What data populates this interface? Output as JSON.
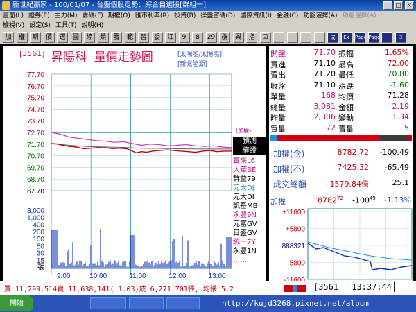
{
  "window": {
    "title": "新世紀贏家 - 100/01/07 - 台盤個股走勢：綜合自選股[群組一]"
  },
  "menu": {
    "row1": [
      "畫面(L)",
      "證券(E)",
      "主力(M)",
      "籌碼(F)",
      "期權(O)",
      "匯市利率(R)",
      "投資(B)",
      "操盤密碼(D)",
      "國際資訊(I)",
      "金融(C)",
      "功能選擇(A)",
      "功能選擇(A)"
    ],
    "row2": [
      "檢視(V)",
      "設定(S)",
      "工具(T)",
      "說明(H)"
    ]
  },
  "toolbar": {
    "buttons": [
      "加",
      "權",
      "期",
      "價",
      "選",
      "國",
      "綜",
      "類",
      "籌",
      "範",
      "智",
      "委",
      "江",
      "9",
      "8",
      "29",
      "群",
      "興",
      "指",
      "☑",
      "",
      "",
      "",
      "",
      "成",
      "Ex",
      "Page",
      "Page",
      "",
      "☐"
    ]
  },
  "chart": {
    "stock_code": "[3561]",
    "stock_name": "昇陽科",
    "chart_title": "量價走勢圖",
    "sectors": [
      "[太陽能/太陽能]",
      "[新兆能源]"
    ],
    "plus_label": "(加權)",
    "price_axis": [
      "77.70",
      "76.70",
      "75.70",
      "74.70",
      "73.70",
      "72.70",
      "71.70",
      "70.70",
      "69.70",
      "68.70",
      "67.70"
    ],
    "volume_axis": [
      "3,000",
      "1,000",
      "400",
      "200",
      "100",
      "50",
      "30",
      "15",
      "張"
    ],
    "time_axis": [
      "9:00",
      "10:00",
      "11:00",
      "12:00",
      "13:00"
    ],
    "broker_label_1": "預測",
    "broker_label_2": "權證",
    "brokers": [
      {
        "name": "寶來L6",
        "color": "#c0108a"
      },
      {
        "name": "大華BE",
        "color": "#c0108a"
      },
      {
        "name": "群益79",
        "color": "#000000"
      },
      {
        "name": "元大DJ",
        "color": "#2090c0"
      },
      {
        "name": "元大DI",
        "color": "#000000"
      },
      {
        "name": "凱基MB",
        "color": "#000000"
      },
      {
        "name": "永豐9N",
        "color": "#c0108a"
      },
      {
        "name": "元富GV",
        "color": "#000000"
      },
      {
        "name": "日盛GV",
        "color": "#000000"
      },
      {
        "name": "統一7Y",
        "color": "#c0108a"
      },
      {
        "name": "永豐1N",
        "color": "#000000"
      },
      {
        "name": "‥‥‥",
        "color": "#c0108a"
      }
    ]
  },
  "quote": {
    "rows": [
      {
        "l1": "開盤",
        "v1": "71.70",
        "l2": "振幅",
        "v2": "1.65%",
        "c1": "#c0108a",
        "c2": "#d00010"
      },
      {
        "l1": "買進",
        "v1": "71.10",
        "l2": "最高",
        "v2": "72.00",
        "c1": "#000000",
        "c2": "#d00010"
      },
      {
        "l1": "賣出",
        "v1": "71.20",
        "l2": "最低",
        "v2": "70.80",
        "c1": "#000000",
        "c2": "#007000"
      },
      {
        "l1": "收盤",
        "v1": "71.10",
        "l2": "漲跌",
        "v2": "-1.60",
        "c1": "#000000",
        "c2": "#007000"
      },
      {
        "l1": "單量",
        "v1": "168",
        "l2": "均價",
        "v2": "71.28",
        "c1": "#c0108a",
        "c2": "#000000"
      },
      {
        "l1": "總量",
        "v1": "3,081",
        "l2": "金額",
        "v2": "2.19",
        "c1": "#c0108a",
        "c2": "#c0108a"
      },
      {
        "l1": "昨量",
        "v1": "2,306",
        "l2": "變動",
        "v2": "1.34",
        "c1": "#c0108a",
        "c2": "#c0108a"
      },
      {
        "l1": "買量",
        "v1": "72",
        "l2": "賣量",
        "v2": "5",
        "c1": "#c0108a",
        "c2": "#c0108a"
      }
    ],
    "index_rows": [
      {
        "label": "加權(含)",
        "value": "8782.72",
        "change": "-100.49"
      },
      {
        "label": "加權(不)",
        "value": "7425.32",
        "change": "-65.49"
      },
      {
        "label": "成交總額",
        "value": "1579.84億",
        "change": "25.1"
      }
    ],
    "mini": {
      "label": "加權",
      "value_main": "8782",
      "value_sub": "72",
      "change_main": "-100",
      "change_sub": "49",
      "pct": "-1.13%",
      "axis": [
        "+11600",
        "+5800",
        "888321",
        "-5800",
        "-11600"
      ]
    }
  },
  "status": {
    "text": "買 11,299,514賣 11,638,141( 1.03)成 6,271,701張, 均張 5.2",
    "code": "3561",
    "time": "13:37:44"
  },
  "taskbar": {
    "start": "開始",
    "watermark": "http://kujd3268.pixnet.net/album"
  },
  "series": {
    "price": [
      [
        0,
        71.75
      ],
      [
        0.03,
        71.72
      ],
      [
        0.06,
        71.6
      ],
      [
        0.1,
        71.5
      ],
      [
        0.14,
        71.45
      ],
      [
        0.18,
        71.3
      ],
      [
        0.22,
        71.35
      ],
      [
        0.26,
        71.4
      ],
      [
        0.3,
        71.38
      ],
      [
        0.34,
        71.32
      ],
      [
        0.38,
        71.35
      ],
      [
        0.42,
        71.3
      ],
      [
        0.45,
        71.1
      ],
      [
        0.47,
        70.95
      ],
      [
        0.5,
        71.05
      ],
      [
        0.53,
        71.0
      ],
      [
        0.56,
        71.1
      ],
      [
        0.6,
        71.15
      ],
      [
        0.64,
        71.2
      ],
      [
        0.68,
        71.15
      ],
      [
        0.72,
        71.1
      ],
      [
        0.76,
        71.05
      ],
      [
        0.8,
        71.0
      ],
      [
        0.84,
        71.1
      ],
      [
        0.88,
        71.15
      ],
      [
        0.92,
        71.05
      ],
      [
        0.96,
        71.1
      ],
      [
        1.0,
        71.1
      ]
    ],
    "avg": [
      [
        0,
        71.75
      ],
      [
        0.1,
        71.6
      ],
      [
        0.2,
        71.5
      ],
      [
        0.3,
        71.45
      ],
      [
        0.4,
        71.42
      ],
      [
        0.5,
        71.35
      ],
      [
        0.6,
        71.33
      ],
      [
        0.7,
        71.3
      ],
      [
        0.8,
        71.29
      ],
      [
        0.9,
        71.28
      ],
      [
        1.0,
        71.28
      ]
    ],
    "index": [
      [
        0,
        72.7
      ],
      [
        0.05,
        72.55
      ],
      [
        0.1,
        72.3
      ],
      [
        0.15,
        72.2
      ],
      [
        0.2,
        72.1
      ],
      [
        0.25,
        72.0
      ],
      [
        0.3,
        71.95
      ],
      [
        0.35,
        71.85
      ],
      [
        0.4,
        71.9
      ],
      [
        0.45,
        71.75
      ],
      [
        0.5,
        71.6
      ],
      [
        0.55,
        71.7
      ],
      [
        0.6,
        71.65
      ],
      [
        0.65,
        71.55
      ],
      [
        0.7,
        71.6
      ],
      [
        0.75,
        71.65
      ],
      [
        0.8,
        71.55
      ],
      [
        0.85,
        71.5
      ],
      [
        0.9,
        71.55
      ],
      [
        0.95,
        71.45
      ],
      [
        1.0,
        71.4
      ]
    ]
  }
}
